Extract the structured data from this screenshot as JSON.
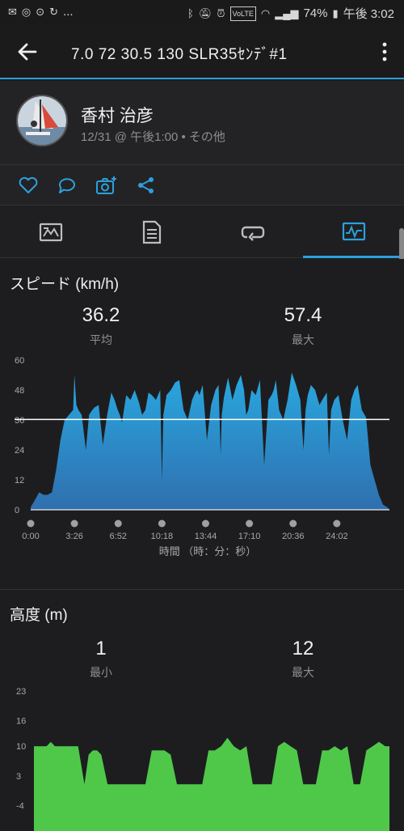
{
  "status_bar": {
    "left_icons": [
      "mail-icon",
      "sync-icon",
      "camera-icon",
      "refresh-icon"
    ],
    "ellipsis": "...",
    "battery": "74%",
    "time": "午後 3:02"
  },
  "app_bar": {
    "title": "7.0  72  30.5  130  SLR35ｾﾝﾃﾞ#1"
  },
  "profile": {
    "name": "香村 治彦",
    "meta": "12/31 @ 午後1:00 • その他"
  },
  "speed": {
    "title": "スピード (km/h)",
    "avg_value": "36.2",
    "avg_label": "平均",
    "max_value": "57.4",
    "max_label": "最大",
    "x_axis_title": "時間 （時：分：秒）"
  },
  "elevation": {
    "title": "高度 (m)",
    "min_value": "1",
    "min_label": "最小",
    "max_value": "12",
    "max_label": "最大"
  },
  "colors": {
    "accent": "#2ca0dc",
    "speed_fill_top": "#29a8e0",
    "speed_fill_bottom": "#2f6fae",
    "elev_fill": "#4fc84a"
  },
  "chart_data": [
    {
      "type": "area",
      "title": "スピード (km/h)",
      "xlabel": "時間 （時：分：秒）",
      "ylabel": "",
      "y_ticks": [
        "0",
        "12",
        "24",
        "36",
        "48",
        "60"
      ],
      "ylim": [
        0,
        60
      ],
      "x_ticks": [
        "0:00",
        "3:26",
        "6:52",
        "10:18",
        "13:44",
        "17:10",
        "20:36",
        "24:02"
      ],
      "xlim_seconds": [
        0,
        1690
      ],
      "avg_line": 36.2,
      "x": [
        0,
        20,
        40,
        60,
        80,
        100,
        120,
        140,
        160,
        180,
        200,
        206,
        215,
        225,
        240,
        260,
        275,
        290,
        300,
        320,
        340,
        360,
        380,
        395,
        410,
        420,
        430,
        450,
        470,
        490,
        510,
        525,
        540,
        555,
        570,
        590,
        610,
        618,
        625,
        640,
        660,
        680,
        700,
        720,
        740,
        760,
        775,
        785,
        795,
        810,
        830,
        850,
        870,
        885,
        895,
        900,
        910,
        930,
        950,
        970,
        990,
        1005,
        1015,
        1025,
        1040,
        1060,
        1080,
        1100,
        1120,
        1135,
        1145,
        1155,
        1170,
        1190,
        1210,
        1230,
        1250,
        1270,
        1285,
        1295,
        1305,
        1320,
        1340,
        1360,
        1380,
        1395,
        1405,
        1415,
        1430,
        1450,
        1470,
        1490,
        1510,
        1525,
        1540,
        1560,
        1580,
        1600,
        1620,
        1640,
        1660,
        1680,
        1690
      ],
      "y": [
        1,
        4,
        7,
        6,
        6,
        7,
        16,
        28,
        36,
        38,
        40,
        54,
        42,
        40,
        38,
        24,
        38,
        40,
        41,
        42,
        26,
        38,
        47,
        44,
        40,
        38,
        35,
        46,
        44,
        48,
        43,
        38,
        40,
        47,
        46,
        44,
        48,
        12,
        38,
        46,
        48,
        51,
        52,
        40,
        36,
        44,
        47,
        48,
        46,
        50,
        28,
        42,
        48,
        50,
        22,
        38,
        45,
        53,
        44,
        50,
        54,
        48,
        38,
        40,
        48,
        46,
        52,
        18,
        44,
        46,
        48,
        52,
        40,
        36,
        44,
        55,
        50,
        44,
        24,
        40,
        46,
        50,
        48,
        42,
        45,
        47,
        22,
        40,
        44,
        46,
        36,
        28,
        44,
        48,
        50,
        40,
        37,
        18,
        12,
        6,
        2,
        1,
        0
      ]
    },
    {
      "type": "area",
      "title": "高度 (m)",
      "y_ticks": [
        "-4",
        "3",
        "10",
        "16",
        "23"
      ],
      "ylim": [
        -10,
        23
      ],
      "x": [
        0,
        20,
        40,
        60,
        80,
        100,
        120,
        150,
        180,
        210,
        240,
        260,
        280,
        300,
        320,
        350,
        380,
        410,
        440,
        470,
        500,
        530,
        560,
        590,
        620,
        650,
        680,
        710,
        740,
        770,
        800,
        830,
        860,
        890,
        920,
        950,
        980,
        1010,
        1040,
        1070,
        1100,
        1130,
        1160,
        1190,
        1220,
        1250,
        1280,
        1310,
        1340,
        1370,
        1400,
        1430,
        1460,
        1490,
        1520,
        1550,
        1580,
        1610,
        1640,
        1670,
        1690
      ],
      "y": [
        10,
        10,
        10,
        10,
        11,
        10,
        10,
        10,
        10,
        10,
        1,
        8,
        9,
        9,
        8,
        1,
        1,
        1,
        1,
        1,
        1,
        1,
        9,
        9,
        9,
        8,
        1,
        1,
        1,
        1,
        1,
        9,
        9,
        10,
        12,
        10,
        9,
        10,
        1,
        1,
        1,
        1,
        10,
        11,
        10,
        9,
        1,
        1,
        1,
        9,
        9,
        10,
        9,
        10,
        1,
        1,
        9,
        10,
        11,
        10,
        10
      ]
    }
  ]
}
